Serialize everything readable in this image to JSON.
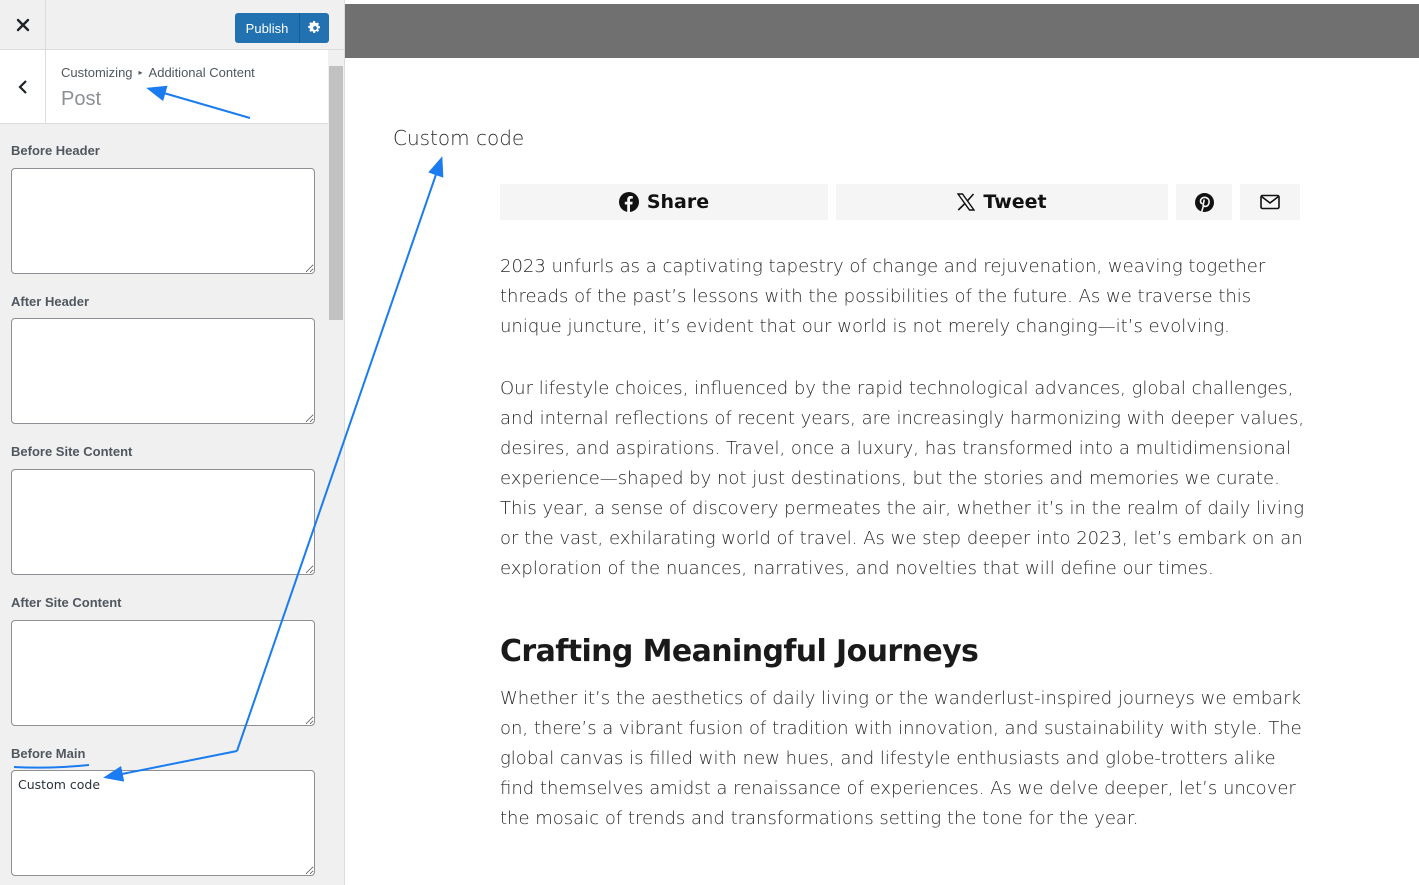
{
  "customizer": {
    "publish_label": "Publish",
    "breadcrumb": {
      "root": "Customizing",
      "current": "Additional Content"
    },
    "section_title": "Post",
    "fields": [
      {
        "label": "Before Header",
        "value": ""
      },
      {
        "label": "After Header",
        "value": ""
      },
      {
        "label": "Before Site Content",
        "value": ""
      },
      {
        "label": "After Site Content",
        "value": ""
      },
      {
        "label": "Before Main",
        "value": "Custom code"
      }
    ]
  },
  "preview": {
    "custom_code": "Custom code",
    "share": {
      "facebook": "Share",
      "twitter": "Tweet"
    },
    "paragraphs": [
      "2023 unfurls as a captivating tapestry of change and rejuvenation, weaving together threads of the past’s lessons with the possibilities of the future. As we traverse this unique juncture, it’s evident that our world is not merely changing—it’s evolving.",
      "Our lifestyle choices, influenced by the rapid technological advances, global challenges, and internal reflections of recent years, are increasingly harmonizing with deeper values, desires, and aspirations. Travel, once a luxury, has transformed into a multidimensional experience—shaped by not just destinations, but the stories and memories we curate. This year, a sense of discovery permeates the air, whether it’s in the realm of daily living or the vast, exhilarating world of travel. As we step deeper into 2023, let’s embark on an exploration of the nuances, narratives, and novelties that will define our times."
    ],
    "heading": "Crafting Meaningful Journeys",
    "paragraph_after_heading": "Whether it’s the aesthetics of daily living or the wanderlust-inspired journeys we embark on, there’s a vibrant fusion of tradition with innovation, and sustainability with style. The global canvas is filled with new hues, and lifestyle enthusiasts and globe-trotters alike find themselves amidst a renaissance of experiences. As we delve deeper, let’s uncover the mosaic of trends and transformations setting the tone for the year."
  },
  "colors": {
    "publish_blue": "#2271b1",
    "annotation_blue": "#1a7cf0",
    "preview_header": "#707070"
  },
  "icons": [
    "close-icon",
    "gear-icon",
    "chevron-left-icon",
    "facebook-icon",
    "x-logo-icon",
    "pinterest-icon",
    "mail-icon"
  ]
}
